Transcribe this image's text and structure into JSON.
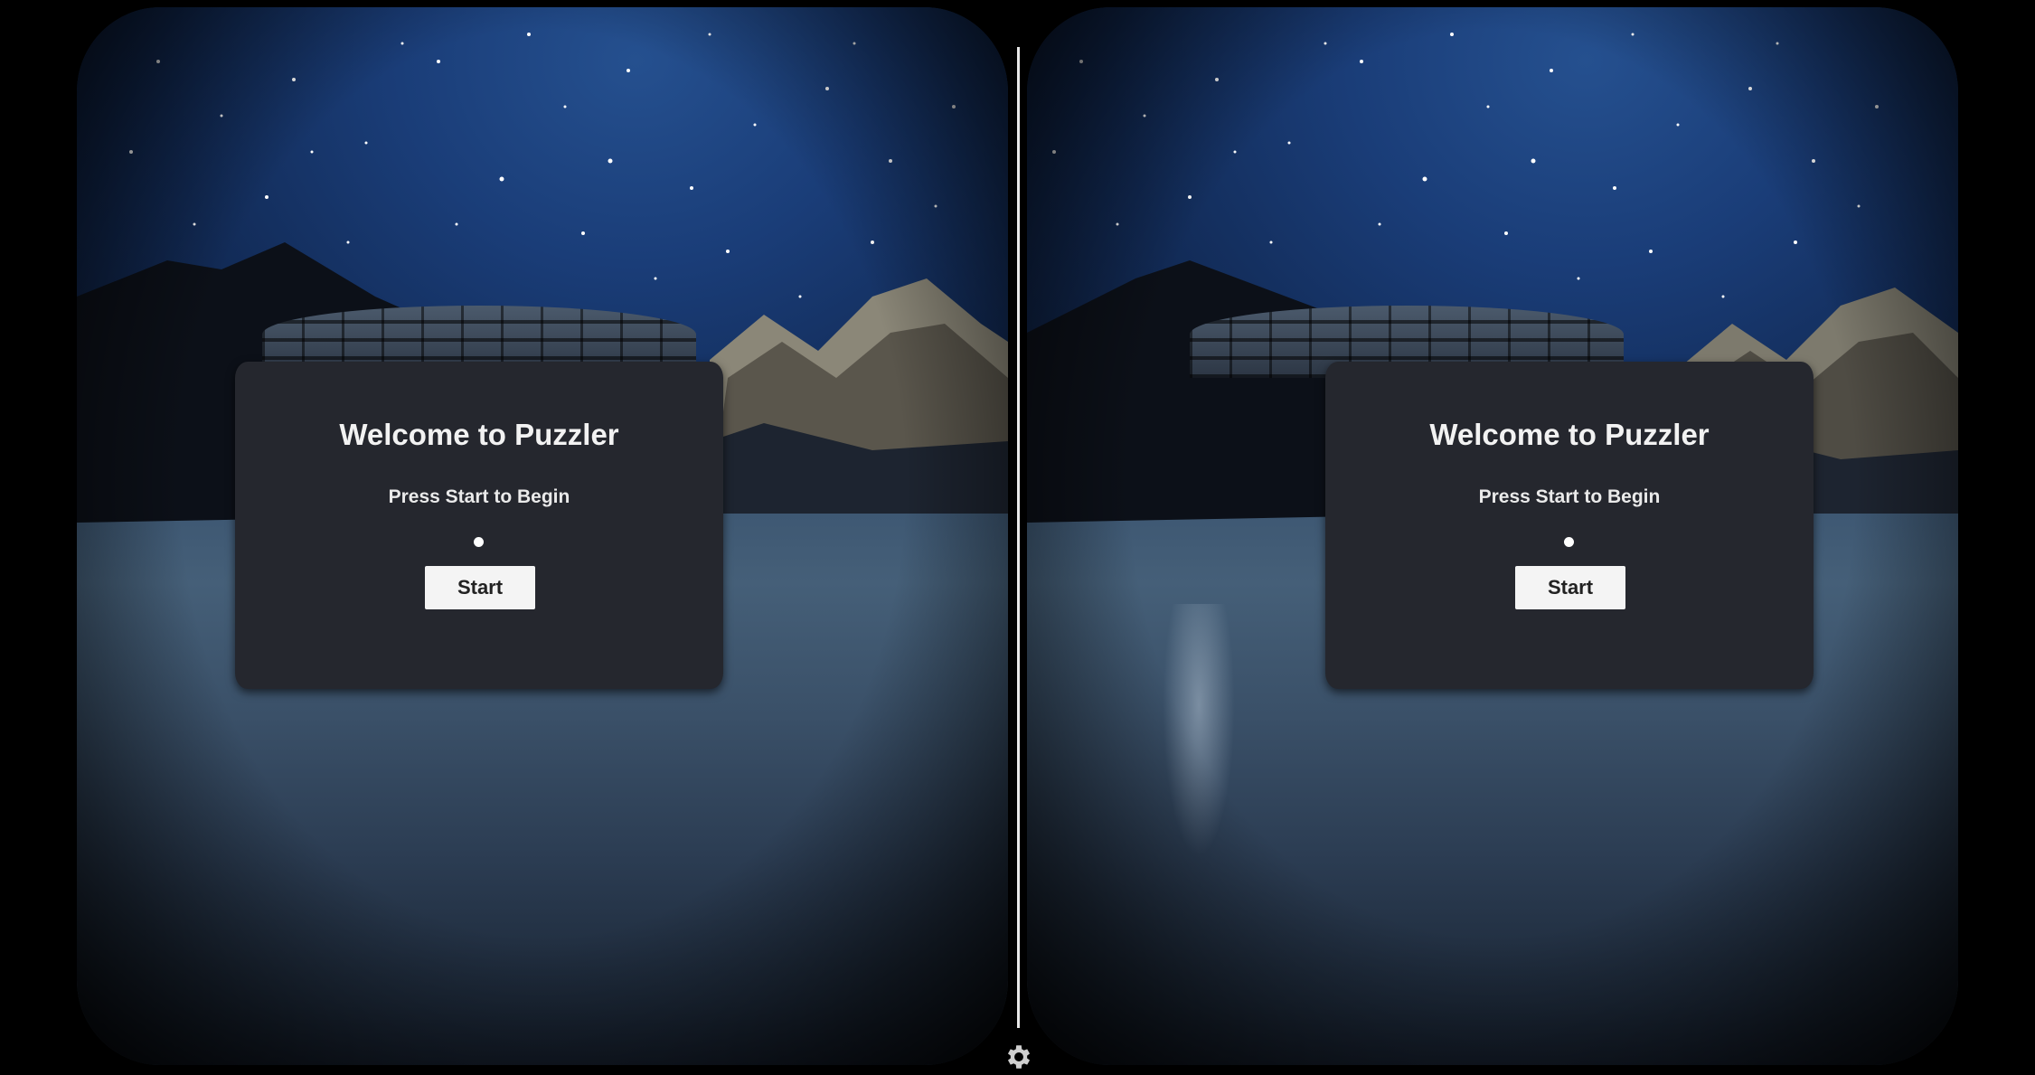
{
  "game": {
    "title": "Welcome to Puzzler",
    "subtitle": "Press Start to Begin",
    "start_label": "Start"
  },
  "hud": {
    "settings_icon": "gear-icon",
    "divider": "eye-divider"
  },
  "colors": {
    "panel": "#25272e",
    "button": "#f4f4f4",
    "sky": "#1a3d78",
    "water": "#3e5873",
    "divider": "#e8e8e8"
  }
}
